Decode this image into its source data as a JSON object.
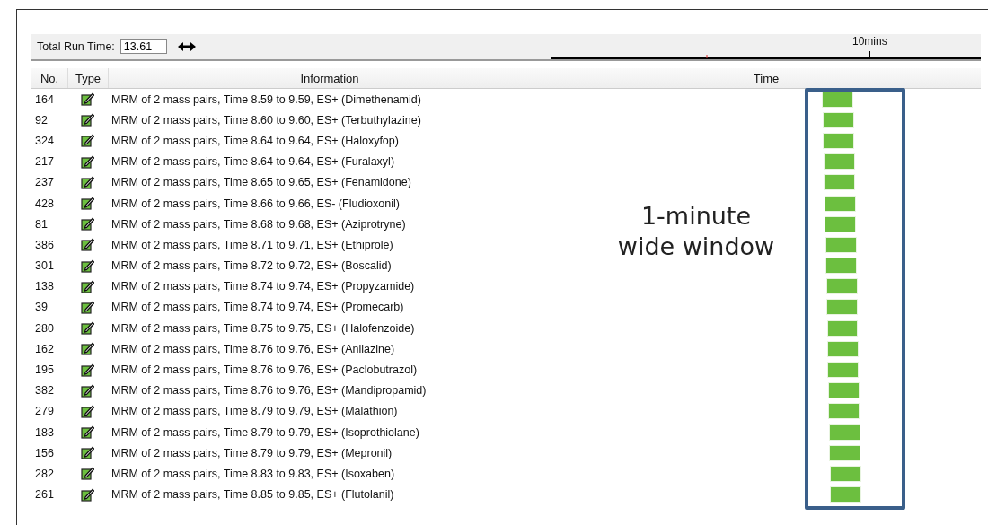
{
  "toolbar": {
    "label": "Total Run Time:",
    "value": "13.61",
    "ruler_label": "10mins"
  },
  "table": {
    "columns": [
      "No.",
      "Type",
      "Information",
      "Time"
    ],
    "rows": [
      {
        "no": "164",
        "info": "MRM of 2 mass pairs, Time 8.59 to 9.59, ES+ (Dimethenamid)"
      },
      {
        "no": "92",
        "info": "MRM of 2 mass pairs, Time 8.60 to 9.60, ES+ (Terbuthylazine)"
      },
      {
        "no": "324",
        "info": "MRM of 2 mass pairs, Time 8.64 to 9.64, ES+ (Haloxyfop)"
      },
      {
        "no": "217",
        "info": "MRM of 2 mass pairs, Time 8.64 to 9.64, ES+ (Furalaxyl)"
      },
      {
        "no": "237",
        "info": "MRM of 2 mass pairs, Time 8.65 to 9.65, ES+ (Fenamidone)"
      },
      {
        "no": "428",
        "info": "MRM of 2 mass pairs, Time 8.66 to 9.66, ES- (Fludioxonil)"
      },
      {
        "no": "81",
        "info": "MRM of 2 mass pairs, Time 8.68 to 9.68, ES+ (Aziprotryne)"
      },
      {
        "no": "386",
        "info": "MRM of 2 mass pairs, Time 8.71 to 9.71, ES+ (Ethiprole)"
      },
      {
        "no": "301",
        "info": "MRM of 2 mass pairs, Time 8.72 to 9.72, ES+ (Boscalid)"
      },
      {
        "no": "138",
        "info": "MRM of 2 mass pairs, Time 8.74 to 9.74, ES+ (Propyzamide)"
      },
      {
        "no": "39",
        "info": "MRM of 2 mass pairs, Time 8.74 to 9.74, ES+ (Promecarb)"
      },
      {
        "no": "280",
        "info": "MRM of 2 mass pairs, Time 8.75 to 9.75, ES+ (Halofenzoide)"
      },
      {
        "no": "162",
        "info": "MRM of 2 mass pairs, Time 8.76 to 9.76, ES+ (Anilazine)"
      },
      {
        "no": "195",
        "info": "MRM of 2 mass pairs, Time 8.76 to 9.76, ES+ (Paclobutrazol)"
      },
      {
        "no": "382",
        "info": "MRM of 2 mass pairs, Time 8.76 to 9.76, ES+ (Mandipropamid)"
      },
      {
        "no": "279",
        "info": "MRM of 2 mass pairs, Time 8.79 to 9.79, ES+ (Malathion)"
      },
      {
        "no": "183",
        "info": "MRM of 2 mass pairs, Time 8.79 to 9.79, ES+ (Isoprothiolane)"
      },
      {
        "no": "156",
        "info": "MRM of 2 mass pairs, Time 8.79 to 9.79, ES+ (Mepronil)"
      },
      {
        "no": "282",
        "info": "MRM of 2 mass pairs, Time 8.83 to 9.83, ES+ (Isoxaben)"
      },
      {
        "no": "261",
        "info": "MRM of 2 mass pairs, Time 8.85 to 9.85, ES+ (Flutolanil)"
      }
    ]
  },
  "annotation": {
    "lines": [
      "1-minute",
      "wide window"
    ]
  }
}
